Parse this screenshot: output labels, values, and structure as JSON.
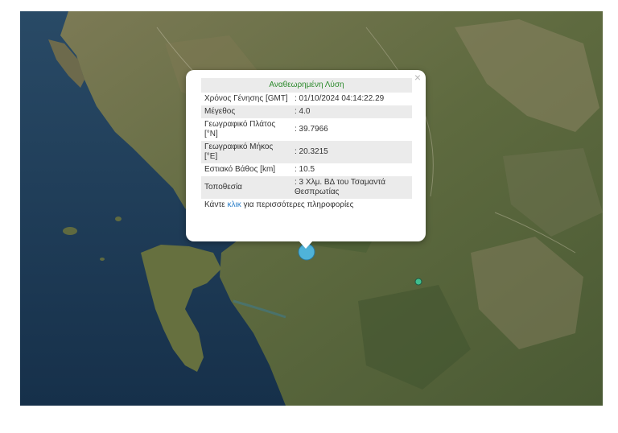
{
  "popup": {
    "header": "Αναθεωρημένη Λύση",
    "close_symbol": "×",
    "rows": [
      {
        "key": "Χρόνος Γένησης [GMT]",
        "value": ": 01/10/2024 04:14:22.29"
      },
      {
        "key": "Μέγεθος",
        "value": ": 4.0"
      },
      {
        "key": "Γεωγραφικό Πλάτος [°N]",
        "value": ": 39.7966"
      },
      {
        "key": "Γεωγραφικό Μήκος [°E]",
        "value": ": 20.3215"
      },
      {
        "key": "Εστιακό Βάθος [km]",
        "value": ": 10.5"
      },
      {
        "key": "Τοποθεσία",
        "value": ": 3 Χλμ. ΒΔ του Τσαμαντά Θεσπρωτίας"
      }
    ],
    "more_prefix": "Κάντε ",
    "more_link": "κλικ",
    "more_suffix": " για περισσότερες πληροφορίες"
  },
  "markers": [
    {
      "type": "selected-earthquake",
      "color": "#4fb3d9"
    },
    {
      "type": "earthquake",
      "color": "#3fbf8f"
    }
  ],
  "colors": {
    "header_green": "#2e8b2e",
    "link_blue": "#2a7ec8",
    "sea": "#1c3a55",
    "land": "#5a6a3e"
  }
}
